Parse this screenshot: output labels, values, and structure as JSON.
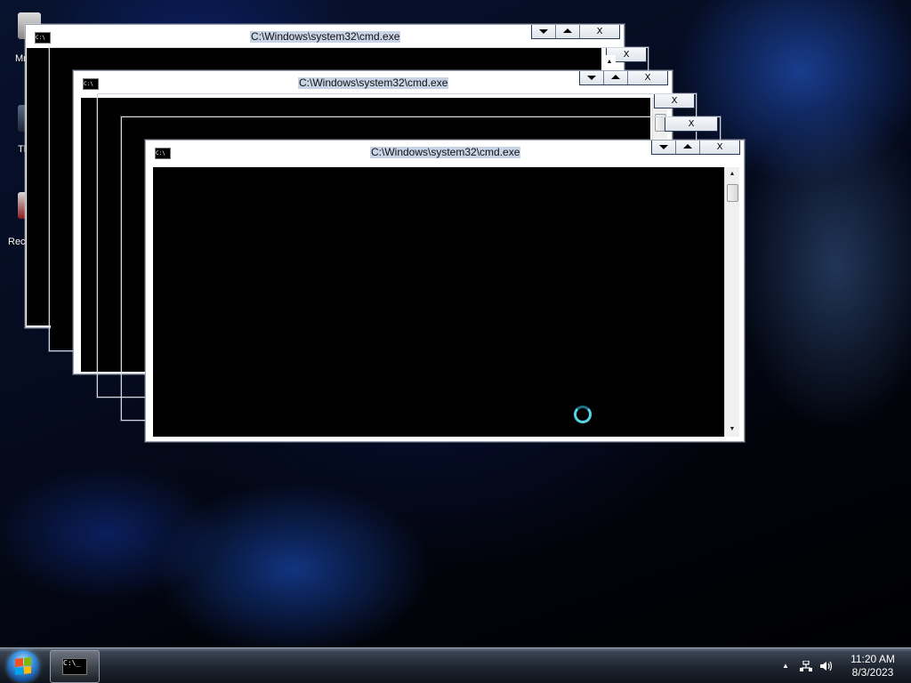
{
  "desktop": {
    "icons": [
      {
        "label": "MrE"
      },
      {
        "label": "Thi"
      },
      {
        "label": "Recy"
      }
    ]
  },
  "windows": {
    "title": "C:\\Windows\\system32\\cmd.exe",
    "icon_text": "C:\\",
    "controls": {
      "minimize_icon": "triangle-down",
      "maximize_icon": "triangle-up",
      "close_label": "X"
    }
  },
  "scrollbar": {
    "up_arrow": "▲",
    "down_arrow": "▼"
  },
  "taskbar": {
    "task_button_icon_text": "C:\\_",
    "tray": {
      "show_hidden_icon": "▲",
      "network_icon": "network-icon",
      "volume_icon": "volume-icon"
    },
    "clock": {
      "time": "11:20 AM",
      "date": "8/3/2023"
    }
  }
}
